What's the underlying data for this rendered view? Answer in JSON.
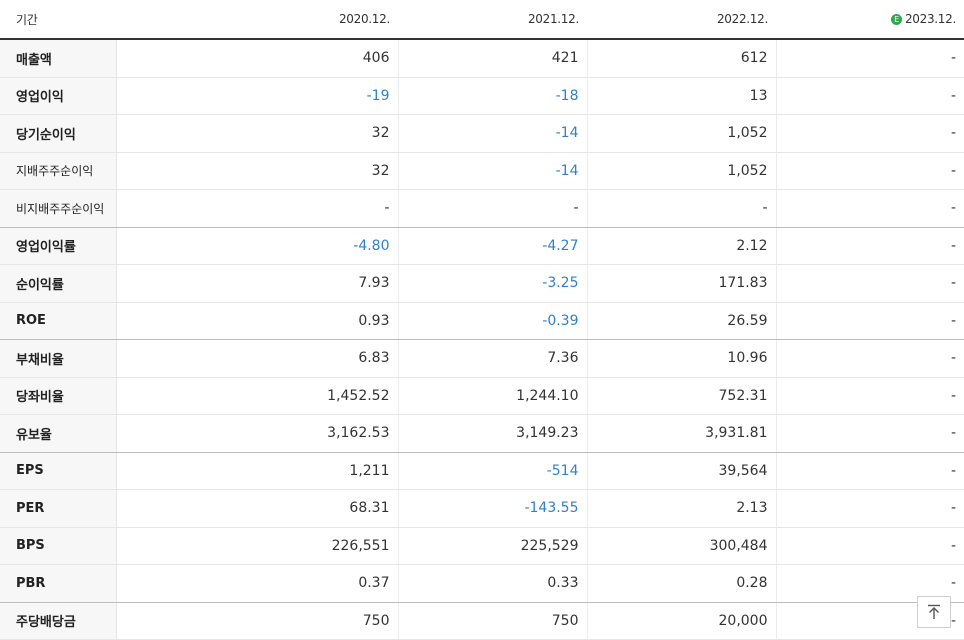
{
  "header": {
    "period_label": "기간",
    "columns": [
      "2020.12.",
      "2021.12.",
      "2022.12.",
      "2023.12."
    ],
    "estimate_badge": "E"
  },
  "rows": [
    {
      "label": "매출액",
      "values": [
        "406",
        "421",
        "612",
        "-"
      ]
    },
    {
      "label": "영업이익",
      "values": [
        "-19",
        "-18",
        "13",
        "-"
      ]
    },
    {
      "label": "당기순이익",
      "values": [
        "32",
        "-14",
        "1,052",
        "-"
      ]
    },
    {
      "label": "지배주주순이익",
      "values": [
        "32",
        "-14",
        "1,052",
        "-"
      ]
    },
    {
      "label": "비지배주주순이익",
      "values": [
        "-",
        "-",
        "-",
        "-"
      ]
    },
    {
      "label": "영업이익률",
      "values": [
        "-4.80",
        "-4.27",
        "2.12",
        "-"
      ]
    },
    {
      "label": "순이익률",
      "values": [
        "7.93",
        "-3.25",
        "171.83",
        "-"
      ]
    },
    {
      "label": "ROE",
      "values": [
        "0.93",
        "-0.39",
        "26.59",
        "-"
      ]
    },
    {
      "label": "부채비율",
      "values": [
        "6.83",
        "7.36",
        "10.96",
        "-"
      ]
    },
    {
      "label": "당좌비율",
      "values": [
        "1,452.52",
        "1,244.10",
        "752.31",
        "-"
      ]
    },
    {
      "label": "유보율",
      "values": [
        "3,162.53",
        "3,149.23",
        "3,931.81",
        "-"
      ]
    },
    {
      "label": "EPS",
      "values": [
        "1,211",
        "-514",
        "39,564",
        "-"
      ]
    },
    {
      "label": "PER",
      "values": [
        "68.31",
        "-143.55",
        "2.13",
        "-"
      ]
    },
    {
      "label": "BPS",
      "values": [
        "226,551",
        "225,529",
        "300,484",
        "-"
      ]
    },
    {
      "label": "PBR",
      "values": [
        "0.37",
        "0.33",
        "0.28",
        "-"
      ]
    },
    {
      "label": "주당배당금",
      "values": [
        "750",
        "750",
        "20,000",
        "-"
      ]
    }
  ],
  "colors": {
    "negative": "#2f80d0",
    "estimate_badge": "#2fa84f"
  },
  "scroll_top_icon": "arrow-up-to-top-icon"
}
